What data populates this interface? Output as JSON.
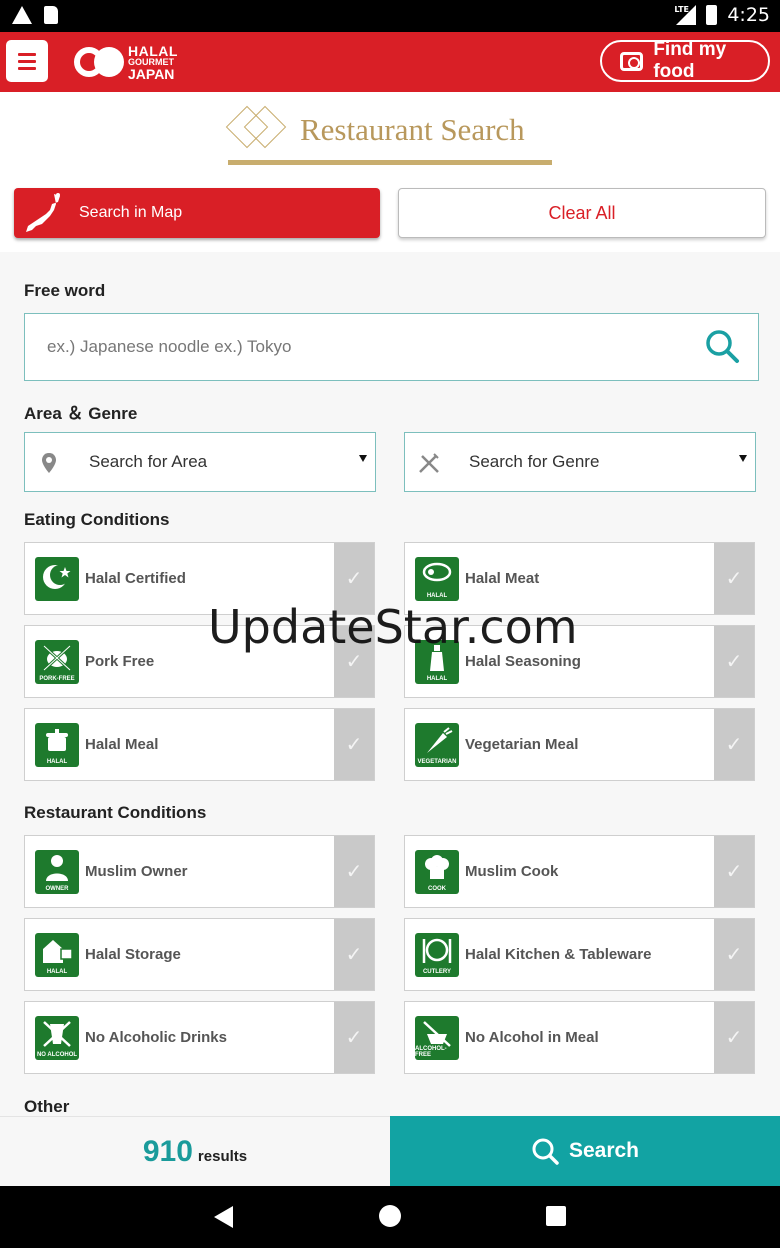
{
  "status_bar": {
    "network": "LTE",
    "time": "4:25"
  },
  "app_header": {
    "logo": {
      "line1": "HALAL",
      "line2": "GOURMET",
      "line3": "JAPAN"
    },
    "find_food_label": "Find my food"
  },
  "page_title": "Restaurant Search",
  "buttons": {
    "search_map": "Search in Map",
    "clear_all": "Clear All"
  },
  "free_word": {
    "label": "Free word",
    "placeholder": "ex.) Japanese noodle ex.) Tokyo"
  },
  "area_genre": {
    "label": "Area ＆ Genre",
    "area_placeholder": "Search for Area",
    "genre_placeholder": "Search for Genre"
  },
  "eating_conditions": {
    "label": "Eating Conditions",
    "items": [
      {
        "label": "Halal Certified",
        "badge": "",
        "icon": "crescent-icon",
        "checked": false
      },
      {
        "label": "Halal Meat",
        "badge": "HALAL",
        "icon": "meat-icon",
        "checked": false
      },
      {
        "label": "Pork Free",
        "badge": "PORK-FREE",
        "icon": "pig-crossed-icon",
        "checked": false
      },
      {
        "label": "Halal Seasoning",
        "badge": "HALAL",
        "icon": "seasoning-bottle-icon",
        "checked": false
      },
      {
        "label": "Halal Meal",
        "badge": "HALAL",
        "icon": "pot-icon",
        "checked": false
      },
      {
        "label": "Vegetarian Meal",
        "badge": "VEGETARIAN",
        "icon": "carrot-icon",
        "checked": false
      }
    ]
  },
  "restaurant_conditions": {
    "label": "Restaurant Conditions",
    "items": [
      {
        "label": "Muslim Owner",
        "badge": "OWNER",
        "icon": "person-icon",
        "checked": false
      },
      {
        "label": "Muslim Cook",
        "badge": "COOK",
        "icon": "chef-hat-icon",
        "checked": false
      },
      {
        "label": "Halal Storage",
        "badge": "HALAL",
        "icon": "storage-icon",
        "checked": false
      },
      {
        "label": "Halal Kitchen & Tableware",
        "badge": "CUTLERY",
        "icon": "cutlery-icon",
        "checked": false
      },
      {
        "label": "No Alcoholic Drinks",
        "badge": "NO ALCOHOL",
        "icon": "no-drink-icon",
        "checked": false
      },
      {
        "label": "No Alcohol in Meal",
        "badge": "ALCOHOL-FREE",
        "icon": "no-alcohol-meal-icon",
        "checked": false
      }
    ]
  },
  "other": {
    "label": "Other"
  },
  "watermark": "UpdateStar.com",
  "bottom_bar": {
    "results_count": "910",
    "results_unit": "results",
    "search_label": "Search"
  },
  "colors": {
    "brand_red": "#d91f26",
    "teal": "#12a3a3",
    "gold": "#b8985c",
    "badge_green": "#1e7a2d"
  }
}
